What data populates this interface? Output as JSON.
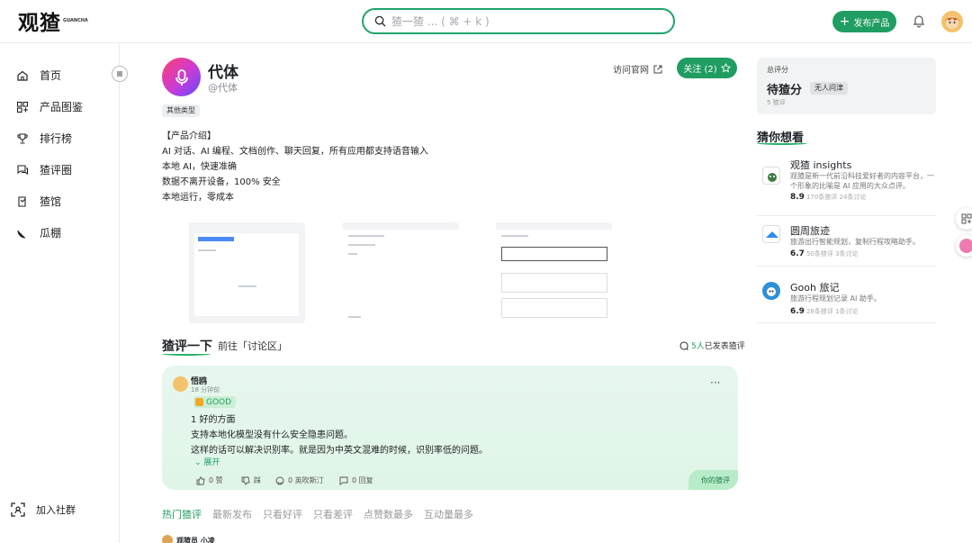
{
  "header": {
    "logo": "观猹",
    "logo_sub": "GUANCHA",
    "search_placeholder": "猹一猹 ... ( ⌘ + k )",
    "publish_label": "发布产品"
  },
  "sidebar": {
    "items": [
      {
        "label": "首页",
        "icon": "home-icon"
      },
      {
        "label": "产品图鉴",
        "icon": "grid-icon"
      },
      {
        "label": "排行榜",
        "icon": "trophy-icon"
      },
      {
        "label": "猹评圈",
        "icon": "chat-icon"
      },
      {
        "label": "猹馆",
        "icon": "book-icon"
      },
      {
        "label": "瓜棚",
        "icon": "melon-icon"
      }
    ],
    "join_label": "加入社群"
  },
  "product": {
    "name": "代体",
    "handle": "@代体",
    "tag": "其他类型",
    "visit_label": "访问官网",
    "follow_label": "关注 (2)",
    "intro": [
      "【产品介绍】",
      "AI 对话、AI 编程、文档创作、聊天回复，所有应用都支持语音输入",
      "本地 AI，快速准确",
      "数据不离开设备，100% 安全",
      "本地运行，零成本"
    ]
  },
  "reviews": {
    "title": "猹评一下",
    "goto_label": "前往「讨论区」",
    "count_num": "5人",
    "count_suffix": "已发表猹评",
    "card": {
      "user": "悟鸥",
      "time": "18 分钟前",
      "rating": "GOOD",
      "lines": [
        "1 好的方面",
        "支持本地化模型没有什么安全隐患问题。",
        "这样的话可以解决识别率。就是因为中英文混难的时候，识别率低的问题。"
      ],
      "expand_label": "展开",
      "likes": "0 赞",
      "dislikes": "踩",
      "laughs": "0 英吹斯汀",
      "replies": "0 回复",
      "yours_label": "你的猹评"
    },
    "filters": [
      "热门猹评",
      "最新发布",
      "只看好评",
      "只看差评",
      "点赞数最多",
      "互动量最多"
    ],
    "next_user": "观猹员 小凌"
  },
  "score": {
    "label": "总评分",
    "value": "待猹分",
    "badge": "无人问津",
    "sub": "5 猹评"
  },
  "recommend": {
    "title": "猜你想看",
    "items": [
      {
        "name": "观猹 insights",
        "desc": "观猹是新一代前沿科技爱好者的内容平台，一个形象的比喻是 AI 应用的大众点评。",
        "score": "8.9",
        "stats": "170条猹评 24条讨论"
      },
      {
        "name": "圆周旅迹",
        "desc": "旅游出行智能规划，复制行程攻略助手。",
        "score": "6.7",
        "stats": "50条猹评 3条讨论"
      },
      {
        "name": "Gooh 旅记",
        "desc": "旅游行程规划记录 AI 助手。",
        "score": "6.9",
        "stats": "28条猹评 1条讨论"
      }
    ]
  },
  "colors": {
    "accent": "#1f9d62",
    "card_bg": "#e6f6ec"
  }
}
